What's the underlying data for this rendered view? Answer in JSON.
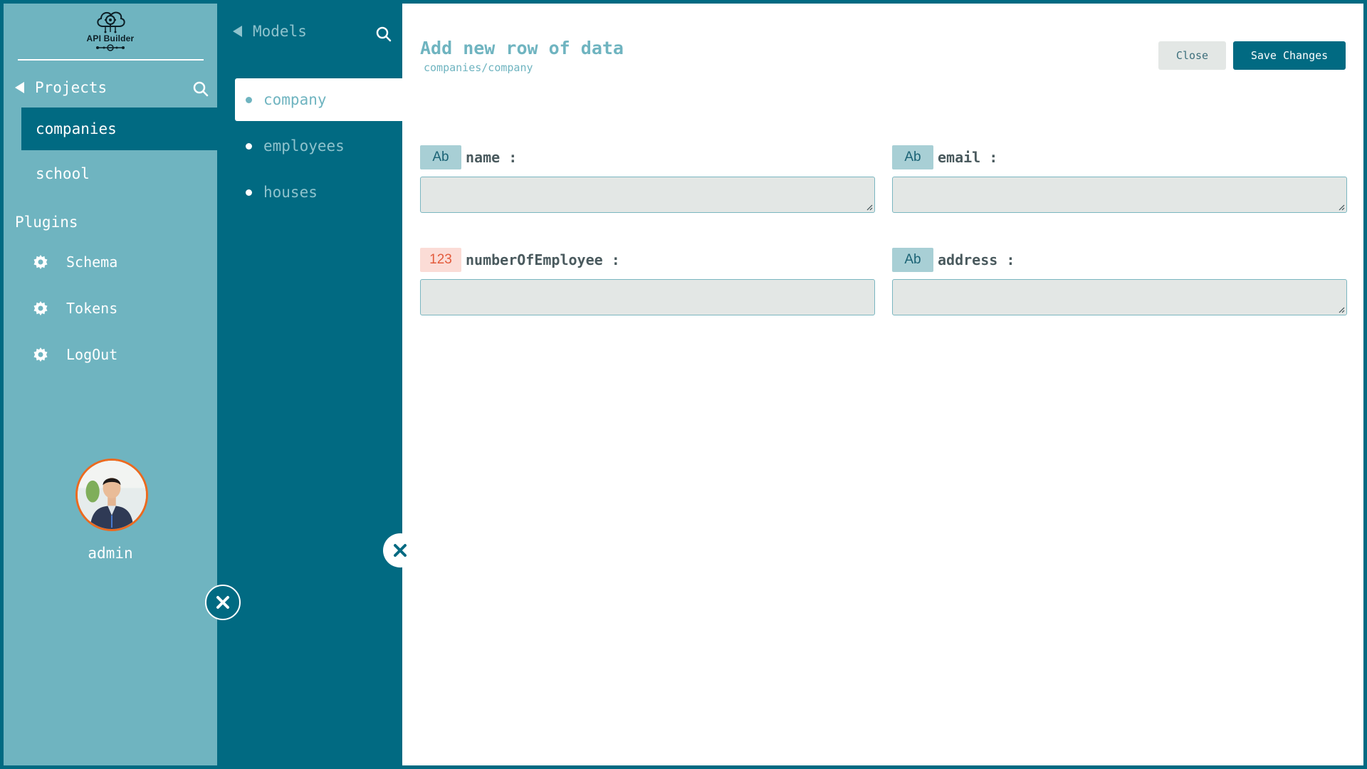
{
  "app": {
    "logo_text": "API Builder"
  },
  "projects": {
    "header_label": "Projects",
    "items": [
      {
        "label": "companies",
        "active": true
      },
      {
        "label": "school",
        "active": false
      }
    ]
  },
  "plugins": {
    "header_label": "Plugins",
    "items": [
      {
        "label": "Schema",
        "icon": "gear-icon"
      },
      {
        "label": "Tokens",
        "icon": "gear-icon"
      },
      {
        "label": "LogOut",
        "icon": "gear-icon"
      }
    ]
  },
  "user": {
    "name": "admin"
  },
  "models": {
    "header_label": "Models",
    "items": [
      {
        "label": "company",
        "active": true
      },
      {
        "label": "employees",
        "active": false
      },
      {
        "label": "houses",
        "active": false
      }
    ]
  },
  "form": {
    "title": "Add new row of data",
    "path": "companies/company",
    "close_label": "Close",
    "save_label": "Save Changes",
    "fields": [
      {
        "badge": "Ab",
        "type": "text",
        "name": "name :",
        "value": ""
      },
      {
        "badge": "Ab",
        "type": "text",
        "name": "email :",
        "value": ""
      },
      {
        "badge": "123",
        "type": "number",
        "name": "numberOfEmployee :",
        "value": ""
      },
      {
        "badge": "Ab",
        "type": "text",
        "name": "address :",
        "value": ""
      }
    ]
  },
  "colors": {
    "sidebar_bg": "#6fb4c0",
    "primary": "#016a82",
    "number_badge": "#e35b3c",
    "avatar_ring": "#ec6a1f"
  }
}
